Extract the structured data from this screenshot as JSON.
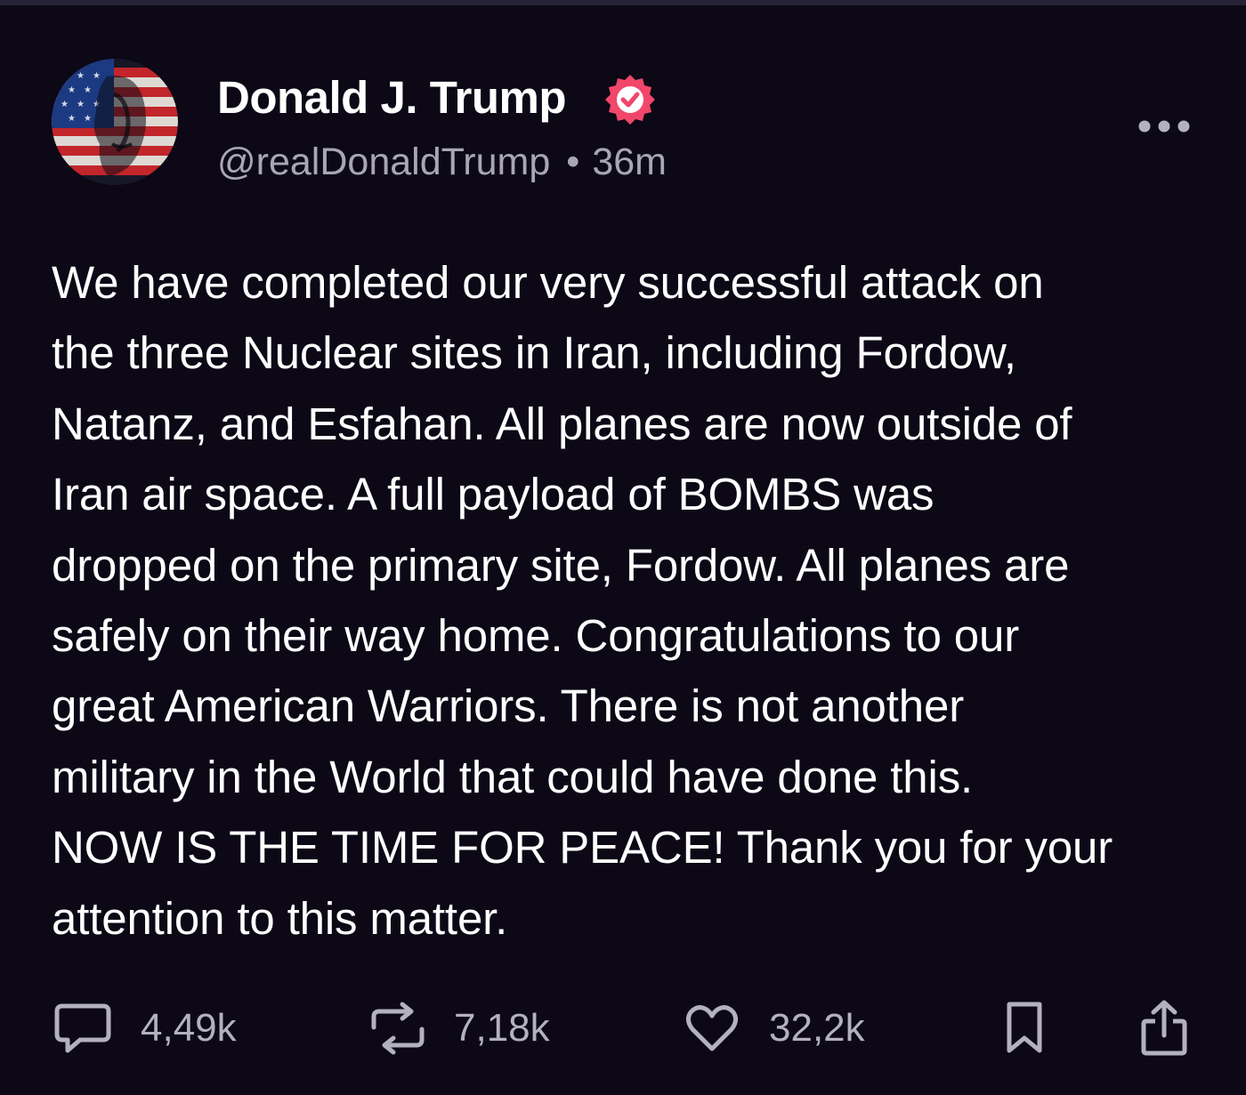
{
  "author": {
    "name": "Donald J. Trump",
    "handle": "@realDonaldTrump",
    "separator": "•",
    "time": "36m",
    "verified_color": "#f0476a",
    "avatar_icon": "flag-portrait-avatar"
  },
  "post": {
    "text": "We have completed our very successful attack on\nthe three Nuclear sites in Iran, including Fordow,\nNatanz, and Esfahan. All planes are now outside of\nIran air space. A full payload of BOMBS was\ndropped on the primary site, Fordow. All planes are\nsafely on their way home. Congratulations to our\ngreat American Warriors. There is not another\nmilitary in the World that could have done this.\nNOW IS THE TIME FOR PEACE! Thank you for your\nattention to this matter."
  },
  "actions": {
    "replies": {
      "icon": "comment-icon",
      "count": "4,49k"
    },
    "reposts": {
      "icon": "repost-icon",
      "count": "7,18k"
    },
    "likes": {
      "icon": "heart-icon",
      "count": "32,2k"
    },
    "bookmark": {
      "icon": "bookmark-icon"
    },
    "share": {
      "icon": "share-icon"
    }
  },
  "colors": {
    "background": "#0c0816",
    "text": "#ffffff",
    "secondary_text": "#a9a6b4",
    "icon": "#b3b0bf"
  }
}
